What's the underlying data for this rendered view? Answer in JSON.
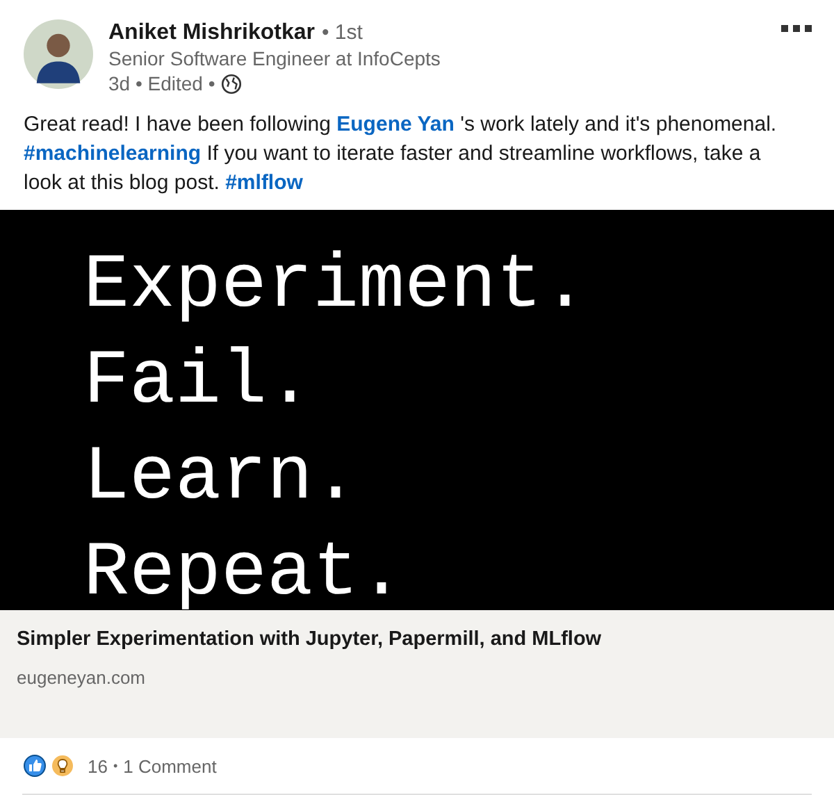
{
  "author": {
    "name": "Aniket Mishrikotkar",
    "degree": "• 1st",
    "headline": "Senior Software Engineer at InfoCepts",
    "meta": "3d • Edited •"
  },
  "post_text": [
    {
      "kind": "text",
      "text": "Great read! I have been following "
    },
    {
      "kind": "link",
      "text": "Eugene Yan"
    },
    {
      "kind": "text",
      "text": " 's work lately and it's phenomenal. "
    },
    {
      "kind": "link",
      "text": "#machinelearning"
    },
    {
      "kind": "text",
      "text": " If you want to iterate faster and streamline workflows, take a look at this blog post. "
    },
    {
      "kind": "link",
      "text": "#mlflow"
    }
  ],
  "image_lines": [
    "Experiment.",
    "Fail.",
    "Learn.",
    "Repeat."
  ],
  "link_card": {
    "title": "Simpler Experimentation with Jupyter, Papermill, and MLflow",
    "domain": "eugeneyan.com"
  },
  "social": {
    "reactions": [
      {
        "kind": "like"
      },
      {
        "kind": "insightful"
      }
    ],
    "count": "16",
    "separator": "•",
    "comments": "1 Comment"
  }
}
